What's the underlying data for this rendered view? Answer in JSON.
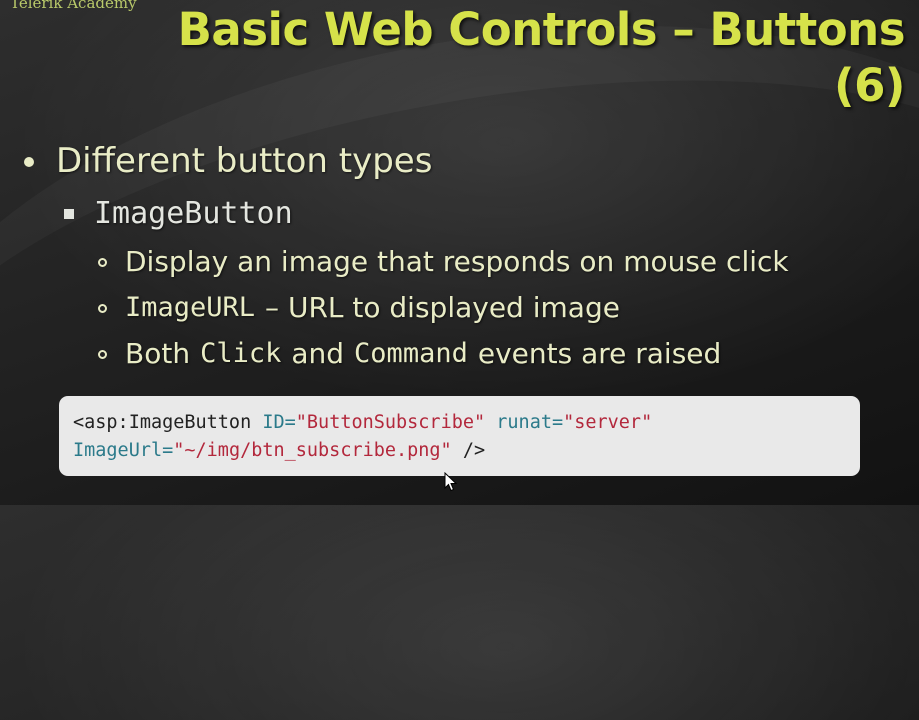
{
  "brand": "Telerik Academy",
  "title": {
    "line1": "Basic Web Controls – Buttons",
    "line2": "(6)"
  },
  "bullets": {
    "level1": "Different button types",
    "level2": "ImageButton",
    "items": [
      {
        "text": "Display an image that responds on mouse click"
      },
      {
        "code": "ImageURL",
        "text": "– URL to displayed image"
      },
      {
        "pre": "Both",
        "code1": "Click",
        "mid": "and",
        "code2": "Command",
        "post": "events are raised"
      }
    ]
  },
  "code_block": {
    "line1": {
      "tag": "<asp:ImageButton",
      "attr1": "ID=",
      "val1": "\"ButtonSubscribe\"",
      "attr2": "runat=",
      "val2": "\"server\""
    },
    "line2": {
      "attr": "ImageUrl=",
      "val": "\"~/img/btn_subscribe.png\"",
      "close": "/>"
    }
  },
  "colors": {
    "title": "#d6e24a",
    "text": "#e9ecc6",
    "code_bg": "#e9e9e9",
    "code_attr": "#2b7a8a",
    "code_string": "#b3283c"
  }
}
